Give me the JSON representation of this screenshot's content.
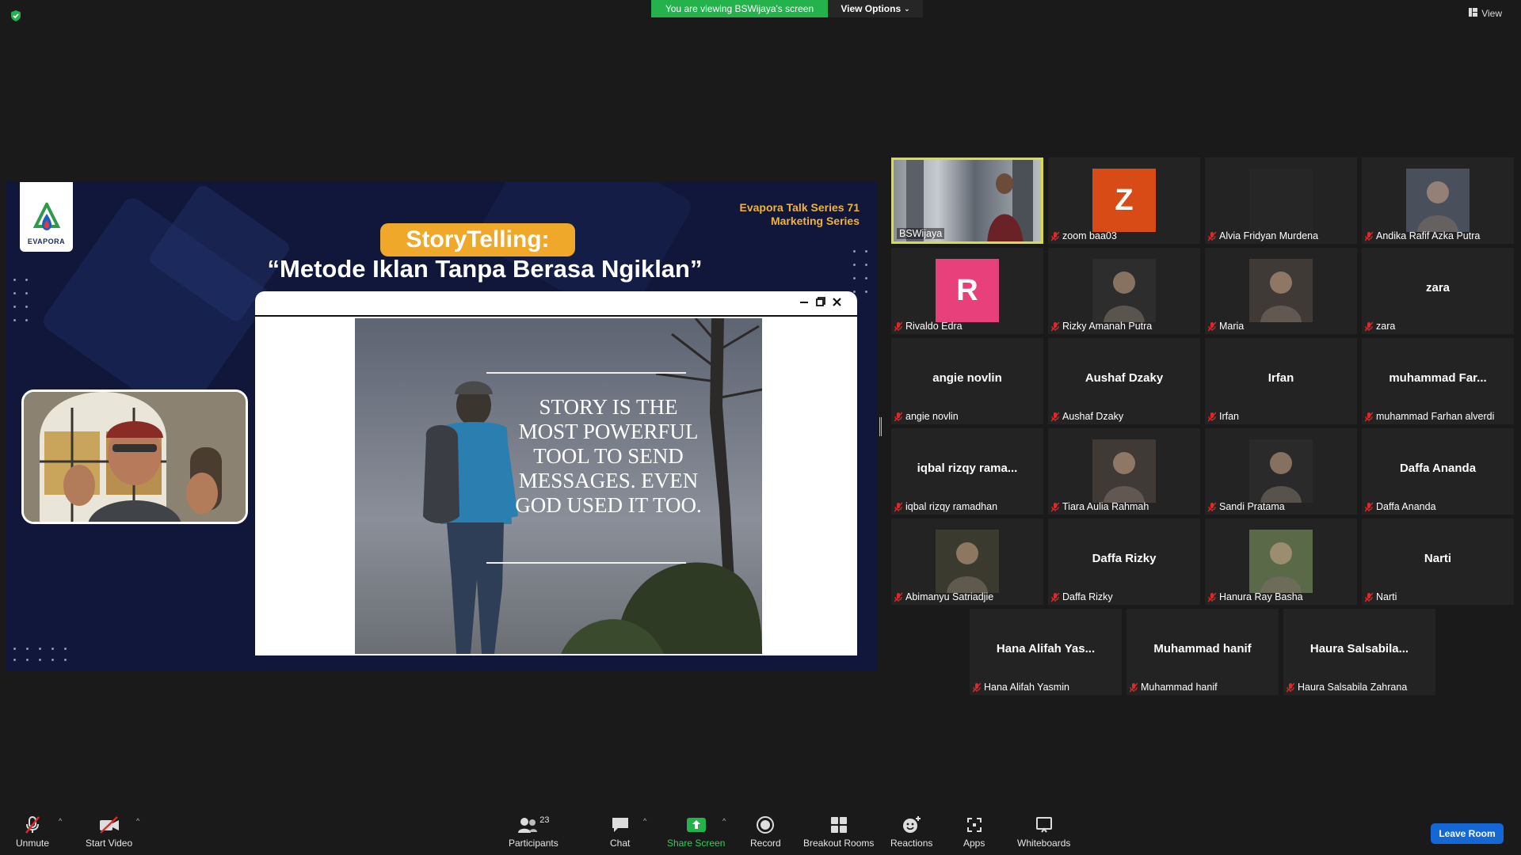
{
  "top": {
    "viewing_banner": "You are viewing BSWijaya's screen",
    "view_options": "View Options",
    "view_button": "View"
  },
  "slide": {
    "logo_text": "EVAPORA",
    "series_line1": "Evapora Talk Series 71",
    "series_line2": "Marketing Series",
    "title": "StoryTelling:",
    "subtitle": "“Metode Iklan Tanpa Berasa Ngiklan”",
    "quote": "STORY IS THE MOST POWERFUL TOOL TO SEND MESSAGES. EVEN GOD USED IT TOO."
  },
  "gallery": [
    {
      "name": "BSWijaya",
      "video": true,
      "active": true,
      "muted": false
    },
    {
      "name": "zoom baa03",
      "letter": "Z",
      "color": "#d84a16",
      "muted": true
    },
    {
      "name": "Alvia Fridyan Murdena",
      "muted": true,
      "blank": true
    },
    {
      "name": "Andika Rafif Azka Putra",
      "photo": true,
      "muted": true
    },
    {
      "name": "Rivaldo Edra",
      "letter": "R",
      "color": "#e8407a",
      "muted": true
    },
    {
      "name": "Rizky Amanah Putra",
      "photo": true,
      "muted": true
    },
    {
      "name": "Maria",
      "photo": true,
      "muted": true
    },
    {
      "name": "zara",
      "center_name": "zara",
      "muted": true
    },
    {
      "name": "angie novlin",
      "center_name": "angie novlin",
      "muted": true
    },
    {
      "name": "Aushaf Dzaky",
      "center_name": "Aushaf Dzaky",
      "muted": true
    },
    {
      "name": "Irfan",
      "center_name": "Irfan",
      "muted": true
    },
    {
      "name": "muhammad Farhan alverdi",
      "center_name": "muhammad  Far...",
      "muted": true
    },
    {
      "name": "iqbal rizqy ramadhan",
      "center_name": "iqbal  rizqy  rama...",
      "muted": true
    },
    {
      "name": "Tiara Aulia Rahmah",
      "photo": true,
      "muted": true
    },
    {
      "name": "Sandi Pratama",
      "photo": true,
      "muted": true
    },
    {
      "name": "Daffa Ananda",
      "center_name": "Daffa Ananda",
      "muted": true
    },
    {
      "name": "Abimanyu Satriadjie",
      "photo": true,
      "muted": true
    },
    {
      "name": "Daffa Rizky",
      "center_name": "Daffa Rizky",
      "muted": true
    },
    {
      "name": "Hanura Ray Basha",
      "photo": true,
      "muted": true
    },
    {
      "name": "Narti",
      "center_name": "Narti",
      "muted": true
    },
    {
      "name": "Hana Alifah Yasmin",
      "center_name": "Hana Alifah Yas...",
      "muted": true
    },
    {
      "name": "Muhammad hanif",
      "center_name": "Muhammad hanif",
      "muted": true
    },
    {
      "name": "Haura Salsabila Zahrana",
      "center_name": "Haura  Salsabila...",
      "muted": true
    }
  ],
  "toolbar": {
    "unmute": "Unmute",
    "start_video": "Start Video",
    "participants": "Participants",
    "participants_count": "23",
    "chat": "Chat",
    "share_screen": "Share Screen",
    "record": "Record",
    "breakout_rooms": "Breakout Rooms",
    "reactions": "Reactions",
    "apps": "Apps",
    "whiteboards": "Whiteboards",
    "leave_room": "Leave Room"
  },
  "colors": {
    "share_green": "#23b24b",
    "active_speaker": "#d8dd42",
    "leave_blue": "#1667d6",
    "muted_red": "#e02828",
    "title_orange": "#f0a82a"
  }
}
